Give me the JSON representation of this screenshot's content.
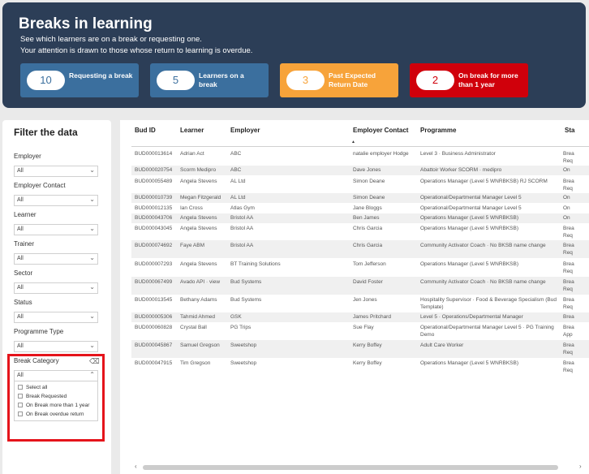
{
  "header": {
    "title": "Breaks in learning",
    "subtitle1": "See which learners are on a break or requesting one.",
    "subtitle2": "Your attention is drawn to those whose return to learning is overdue."
  },
  "cards": [
    {
      "value": "10",
      "label": "Requesting a break"
    },
    {
      "value": "5",
      "label": "Learners on a break"
    },
    {
      "value": "3",
      "label": "Past Expected Return Date"
    },
    {
      "value": "2",
      "label": "On break for more than 1 year"
    }
  ],
  "filters": {
    "title": "Filter the data",
    "items": [
      {
        "label": "Employer",
        "value": "All"
      },
      {
        "label": "Employer Contact",
        "value": "All"
      },
      {
        "label": "Learner",
        "value": "All"
      },
      {
        "label": "Trainer",
        "value": "All"
      },
      {
        "label": "Sector",
        "value": "All"
      },
      {
        "label": "Status",
        "value": "All"
      },
      {
        "label": "Programme Type",
        "value": "All"
      },
      {
        "label": "Break Category",
        "value": "All"
      }
    ],
    "break_options": [
      "Select all",
      "Break Requested",
      "On Break more than 1 year",
      "On Break overdue return"
    ]
  },
  "table": {
    "columns": [
      "Bud ID",
      "Learner",
      "Employer",
      "Employer Contact",
      "Programme",
      "Sta"
    ],
    "rows": [
      {
        "id": "BUD000013614",
        "learner": "Adrian Act",
        "employer": "ABC",
        "contact": "natalie employer Hodge",
        "programme": "Level 3 · Business Administrator",
        "status": "Brea Req"
      },
      {
        "id": "BUD000020754",
        "learner": "Scorm Medipro",
        "employer": "ABC",
        "contact": "Dave Jones",
        "programme": "Abattoir Worker SCORM · medipro",
        "status": "On"
      },
      {
        "id": "BUD000055489",
        "learner": "Angela Stevens",
        "employer": "AL Ltd",
        "contact": "Simon Deane",
        "programme": "Operations Manager (Level 5 WNRBKSB) RJ SCORM",
        "status": "Brea Req"
      },
      {
        "id": "BUD000010739",
        "learner": "Megan Fitzgerald",
        "employer": "AL Ltd",
        "contact": "Simon Deane",
        "programme": "Operational/Departmental Manager Level 5",
        "status": "On"
      },
      {
        "id": "BUD000012135",
        "learner": "Ian Cross",
        "employer": "Atlas Gym",
        "contact": "Jane Bloggs",
        "programme": "Operational/Departmental Manager Level 5",
        "status": "On"
      },
      {
        "id": "BUD000043706",
        "learner": "Angela Stevens",
        "employer": "Bristol AA",
        "contact": "Ben James",
        "programme": "Operations Manager (Level 5 WNRBKSB)",
        "status": "On"
      },
      {
        "id": "BUD000043045",
        "learner": "Angela Stevens",
        "employer": "Bristol AA",
        "contact": "Chris Garcia",
        "programme": "Operations Manager (Level 5 WNRBKSB)",
        "status": "Brea Req"
      },
      {
        "id": "BUD000074692",
        "learner": "Faye ABM",
        "employer": "Bristol AA",
        "contact": "Chris Garcia",
        "programme": "Community Activator Coach · No BKSB name change",
        "status": "Brea Req"
      },
      {
        "id": "BUD000007293",
        "learner": "Angela Stevens",
        "employer": "BT Training Solutions",
        "contact": "Tom Jefferson",
        "programme": "Operations Manager (Level 5 WNRBKSB)",
        "status": "Brea Req"
      },
      {
        "id": "BUD000067499",
        "learner": "Avado API · view",
        "employer": "Bud Systems",
        "contact": "David Foster",
        "programme": "Community Activator Coach · No BKSB name change",
        "status": "Brea Req"
      },
      {
        "id": "BUD000013545",
        "learner": "Bethany Adams",
        "employer": "Bud Systems",
        "contact": "Jen Jones",
        "programme": "Hospitality Supervisor · Food & Beverage Specialism (Bud Template)",
        "status": "Brea Req"
      },
      {
        "id": "BUD000005306",
        "learner": "Tahmid Ahmed",
        "employer": "GSK",
        "contact": "James Pritchard",
        "programme": "Level 5 · Operations/Departmental Manager",
        "status": "Brea"
      },
      {
        "id": "BUD000060828",
        "learner": "Crystal Ball",
        "employer": "PG Trips",
        "contact": "Sue Flay",
        "programme": "Operational/Departmental Manager Level 5 · PG Training Demo",
        "status": "Brea App"
      },
      {
        "id": "BUD000045867",
        "learner": "Samuel Gregson",
        "employer": "Sweetshop",
        "contact": "Kerry Boffey",
        "programme": "Adult Care Worker",
        "status": "Brea Req"
      },
      {
        "id": "BUD000047915",
        "learner": "Tim Gregson",
        "employer": "Sweetshop",
        "contact": "Kerry Boffey",
        "programme": "Operations Manager (Level 5 WNRBKSB)",
        "status": "Brea Req"
      }
    ]
  },
  "icons": {
    "dropdown": "chevron-down-icon",
    "dropdown_open": "chevron-up-icon",
    "eraser": "eraser-icon",
    "sort": "sort-desc-icon"
  }
}
